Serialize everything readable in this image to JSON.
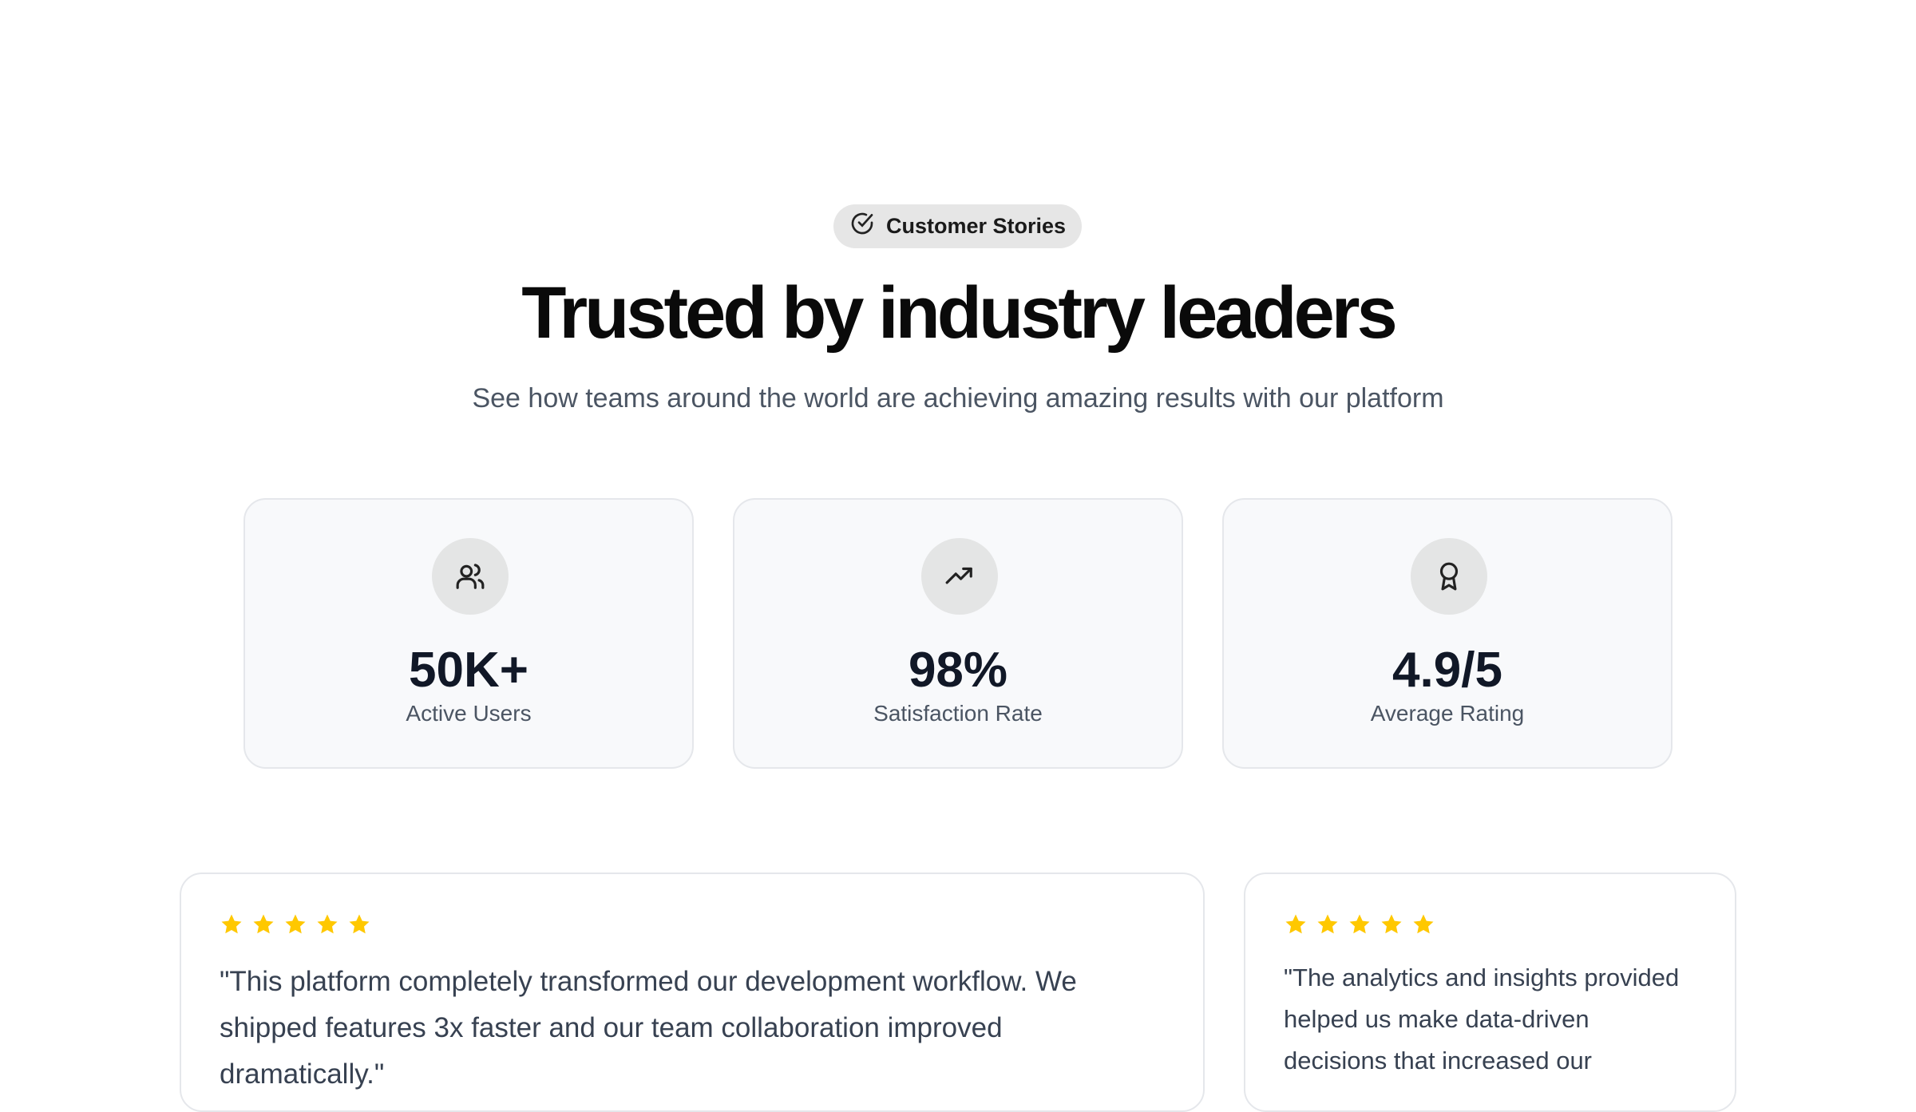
{
  "badge": {
    "icon": "check-circle-icon",
    "label": "Customer Stories"
  },
  "header": {
    "title": "Trusted by industry leaders",
    "subtitle": "See how teams around the world are achieving amazing results with our platform"
  },
  "stats": [
    {
      "icon": "users-icon",
      "value": "50K+",
      "label": "Active Users"
    },
    {
      "icon": "trending-up-icon",
      "value": "98%",
      "label": "Satisfaction Rate"
    },
    {
      "icon": "award-icon",
      "value": "4.9/5",
      "label": "Average Rating"
    }
  ],
  "testimonials": [
    {
      "rating": 5,
      "quote": "\"This platform completely transformed our development workflow. We shipped features 3x faster and our team collaboration improved dramatically.\""
    },
    {
      "rating": 5,
      "quote": "\"The analytics and insights provided helped us make data-driven decisions that increased our"
    }
  ],
  "colors": {
    "star": "#FFC800",
    "badge_bg": "#E6E6E6",
    "card_bg": "#F8F9FB"
  }
}
